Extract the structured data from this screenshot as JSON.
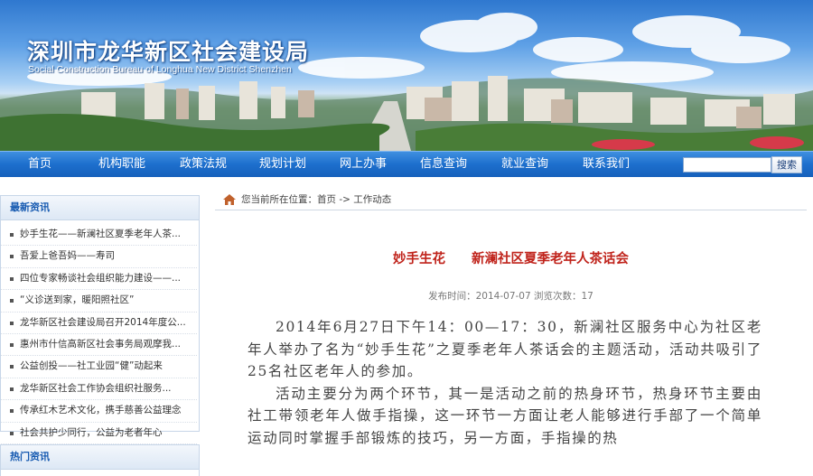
{
  "header": {
    "title": "深圳市龙华新区社会建设局",
    "subtitle": "Social Construction Bureau of Longhua New District Shenzhen"
  },
  "nav": {
    "items": [
      "首页",
      "机构职能",
      "政策法规",
      "规划计划",
      "网上办事",
      "信息查询",
      "就业查询",
      "联系我们"
    ],
    "search_placeholder": "",
    "search_button": "搜索"
  },
  "sidebar": {
    "top_news": {
      "title": "最新资讯",
      "items": [
        "妙手生花——新澜社区夏季老年人茶...",
        "吾爱上爸吾妈——寿司",
        "四位专家畅谈社会组织能力建设——...",
        "“义诊送到家，暖阳照社区”",
        "龙华新区社会建设局召开2014年度公...",
        "惠州市什信高新区社会事务局观摩我...",
        "公益创投——社工业园“健”动起来",
        "龙华新区社会工作协会组织社服务...",
        "传承红木艺术文化，携手慈善公益理念",
        "社会共护少同行，公益为老者年心"
      ]
    },
    "hot_news": {
      "title": "热门资讯"
    }
  },
  "breadcrumb": {
    "prefix": "您当前所在位置：",
    "home": "首页",
    "sep": "->",
    "current": "工作动态"
  },
  "article": {
    "title": "妙手生花　　新澜社区夏季老年人茶话会",
    "meta": "发布时间：2014-07-07 浏览次数：17",
    "paragraphs": [
      "2014年6月27日下午14：00—17：30，新澜社区服务中心为社区老年人举办了名为“妙手生花”之夏季老年人茶话会的主题活动，活动共吸引了25名社区老年人的参加。",
      "活动主要分为两个环节，其一是活动之前的热身环节，热身环节主要由社工带领老年人做手指操，这一环节一方面让老人能够进行手部了一个简单运动同时掌握手部锻炼的技巧，另一方面，手指操的热"
    ]
  }
}
